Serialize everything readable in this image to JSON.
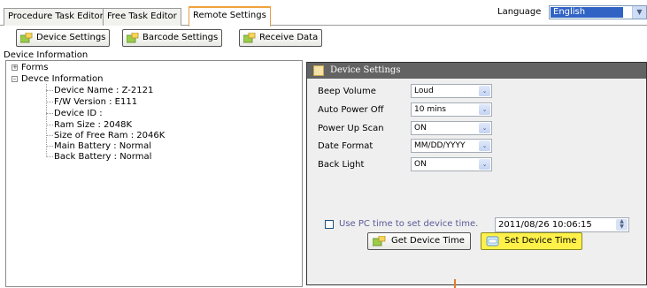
{
  "tabs": [
    {
      "label": "Procedure Task Editor"
    },
    {
      "label": "Free Task Editor"
    },
    {
      "label": "Remote Settings"
    }
  ],
  "language": {
    "label": "Language",
    "value": "English"
  },
  "toolbar": {
    "device_settings": "Device Settings",
    "barcode_settings": "Barcode Settings",
    "receive_data": "Receive Data"
  },
  "device_info": {
    "title": "Device Information",
    "tree": {
      "forms": "Forms",
      "devce_info": "Devce Information",
      "items": [
        "Device Name : Z-2121",
        "F/W Version : E111",
        "Device ID :",
        "Ram Size : 2048K",
        "Size of Free Ram : 2046K",
        "Main Battery : Normal",
        "Back Battery : Normal"
      ]
    }
  },
  "settings": {
    "header": "Device Settings",
    "rows": [
      {
        "label": "Beep Volume",
        "value": "Loud"
      },
      {
        "label": "Auto Power Off",
        "value": "10 mins"
      },
      {
        "label": "Power Up Scan",
        "value": "ON"
      },
      {
        "label": "Date Format",
        "value": "MM/DD/YYYY"
      },
      {
        "label": "Back Light",
        "value": "ON"
      }
    ],
    "use_pc_time_label": "Use PC time to set device time.",
    "use_pc_time_checked": false,
    "datetime": "2011/08/26 10:06:15",
    "get_time": "Get Device Time",
    "set_time": "Set Device Time"
  },
  "colors": {
    "active_tab_border": "#f0a23c",
    "panel_header": "#636363",
    "selection": "#3163c5",
    "set_button": "#fff14a"
  }
}
